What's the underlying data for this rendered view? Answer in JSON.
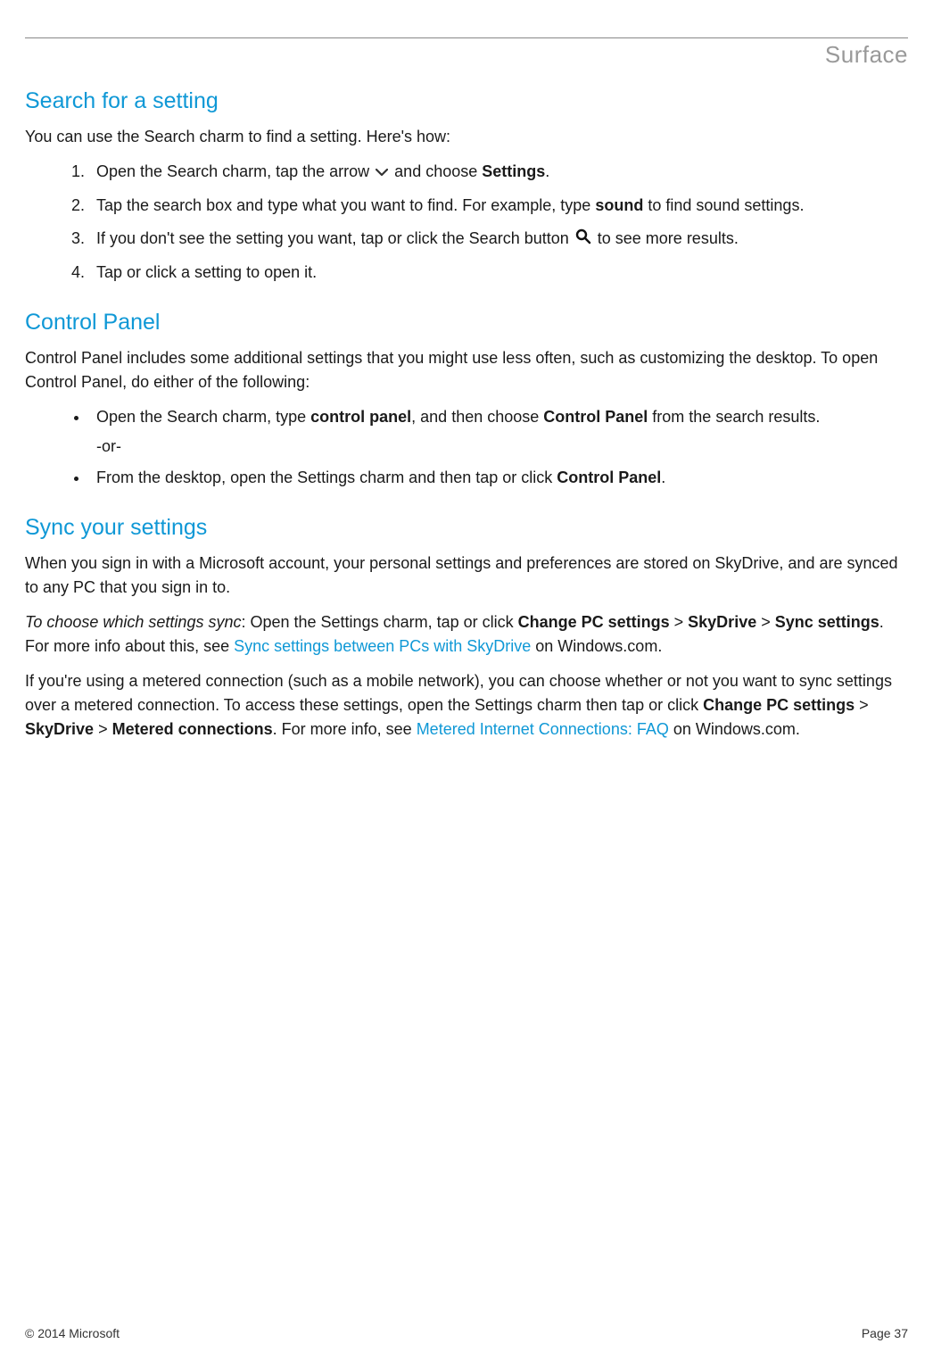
{
  "brand": "Surface",
  "sections": {
    "search": {
      "heading": "Search for a setting",
      "intro": "You can use the Search charm to find a setting. Here's how:",
      "steps": {
        "s1a": "Open the Search charm, tap the arrow ",
        "s1b": " and choose ",
        "s1c": "Settings",
        "s1d": ".",
        "s2a": "Tap the search box and type what you want to find. For example, type ",
        "s2b": "sound",
        "s2c": " to find sound settings.",
        "s3a": "If you don't see the setting you want, tap or click the Search button ",
        "s3b": " to see more results.",
        "s4": "Tap or click a setting to open it."
      }
    },
    "control": {
      "heading": "Control Panel",
      "intro": "Control Panel includes some additional settings that you might use less often, such as customizing the desktop. To open Control Panel, do either of the following:",
      "b1a": "Open the Search charm, type ",
      "b1b": "control panel",
      "b1c": ", and then choose ",
      "b1d": "Control Panel",
      "b1e": " from the search results.",
      "or": "-or-",
      "b2a": "From the desktop, open the Settings charm and then tap or click ",
      "b2b": "Control Panel",
      "b2c": "."
    },
    "sync": {
      "heading": "Sync your settings",
      "p1": "When you sign in with a Microsoft account, your personal settings and preferences are stored on SkyDrive, and are synced to any PC that you sign in to.",
      "p2a": "To choose which settings sync",
      "p2b": ": Open the Settings charm, tap or click ",
      "p2c": "Change PC settings",
      "p2d": " > ",
      "p2e": "SkyDrive",
      "p2f": " > ",
      "p2g": "Sync settings",
      "p2h": ". For more info about this, see ",
      "p2link": "Sync settings between PCs with SkyDrive",
      "p2i": " on Windows.com.",
      "p3a": "If you're using a metered connection (such as a mobile network), you can choose whether or not you want to sync settings over a metered connection. To access these settings, open the Settings charm then tap or click ",
      "p3b": "Change PC settings",
      "p3c": " > ",
      "p3d": "SkyDrive",
      "p3e": " > ",
      "p3f": "Metered connections",
      "p3g": ". For more info, see ",
      "p3link": "Metered Internet Connections: FAQ",
      "p3h": " on Windows.com."
    }
  },
  "footer": {
    "copyright": "© 2014 Microsoft",
    "page": "Page 37"
  }
}
